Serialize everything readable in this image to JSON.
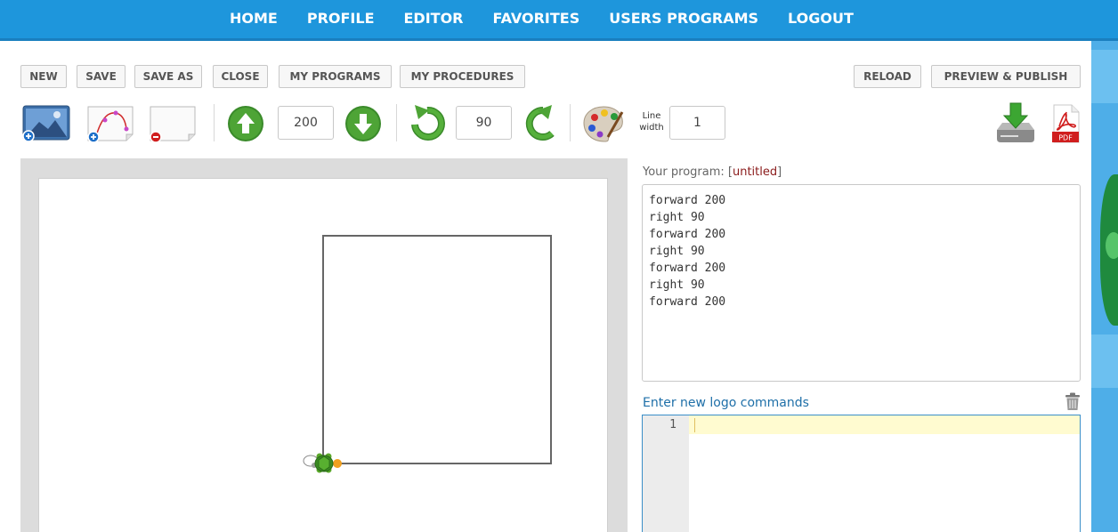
{
  "nav": {
    "items": [
      "HOME",
      "PROFILE",
      "EDITOR",
      "FAVORITES",
      "USERS PROGRAMS",
      "LOGOUT"
    ]
  },
  "toolbar": {
    "new": "NEW",
    "save": "SAVE",
    "save_as": "SAVE AS",
    "close": "CLOSE",
    "my_programs": "MY PROGRAMS",
    "my_procedures": "MY PROCEDURES",
    "reload": "RELOAD",
    "preview_publish": "PREVIEW & PUBLISH"
  },
  "controls": {
    "move_value": "200",
    "turn_value": "90",
    "line_width_label_1": "Line",
    "line_width_label_2": "width",
    "line_width_value": "1",
    "pdf_label": "PDF"
  },
  "program": {
    "label": "Your program: ",
    "bracket_open": "[",
    "name": "untitled",
    "bracket_close": "]",
    "lines": [
      "forward 200",
      "right 90",
      "forward 200",
      "right 90",
      "forward 200",
      "right 90",
      "forward 200"
    ]
  },
  "editor": {
    "label": "Enter new logo commands",
    "line_number": "1"
  },
  "colors": {
    "nav_bg": "#1e96dc",
    "accent_green": "#3a8a2a",
    "editor_border": "#3a8ec8",
    "link_blue": "#1e6fa8"
  },
  "icons": {
    "new_image": "image-plus-icon",
    "new_path": "path-plus-icon",
    "remove": "page-minus-icon",
    "forward": "arrow-up-icon",
    "back": "arrow-down-icon",
    "turn_left": "rotate-left-icon",
    "turn_right": "rotate-right-icon",
    "palette": "palette-icon",
    "download": "download-icon",
    "pdf": "pdf-icon",
    "trash": "trash-icon"
  }
}
